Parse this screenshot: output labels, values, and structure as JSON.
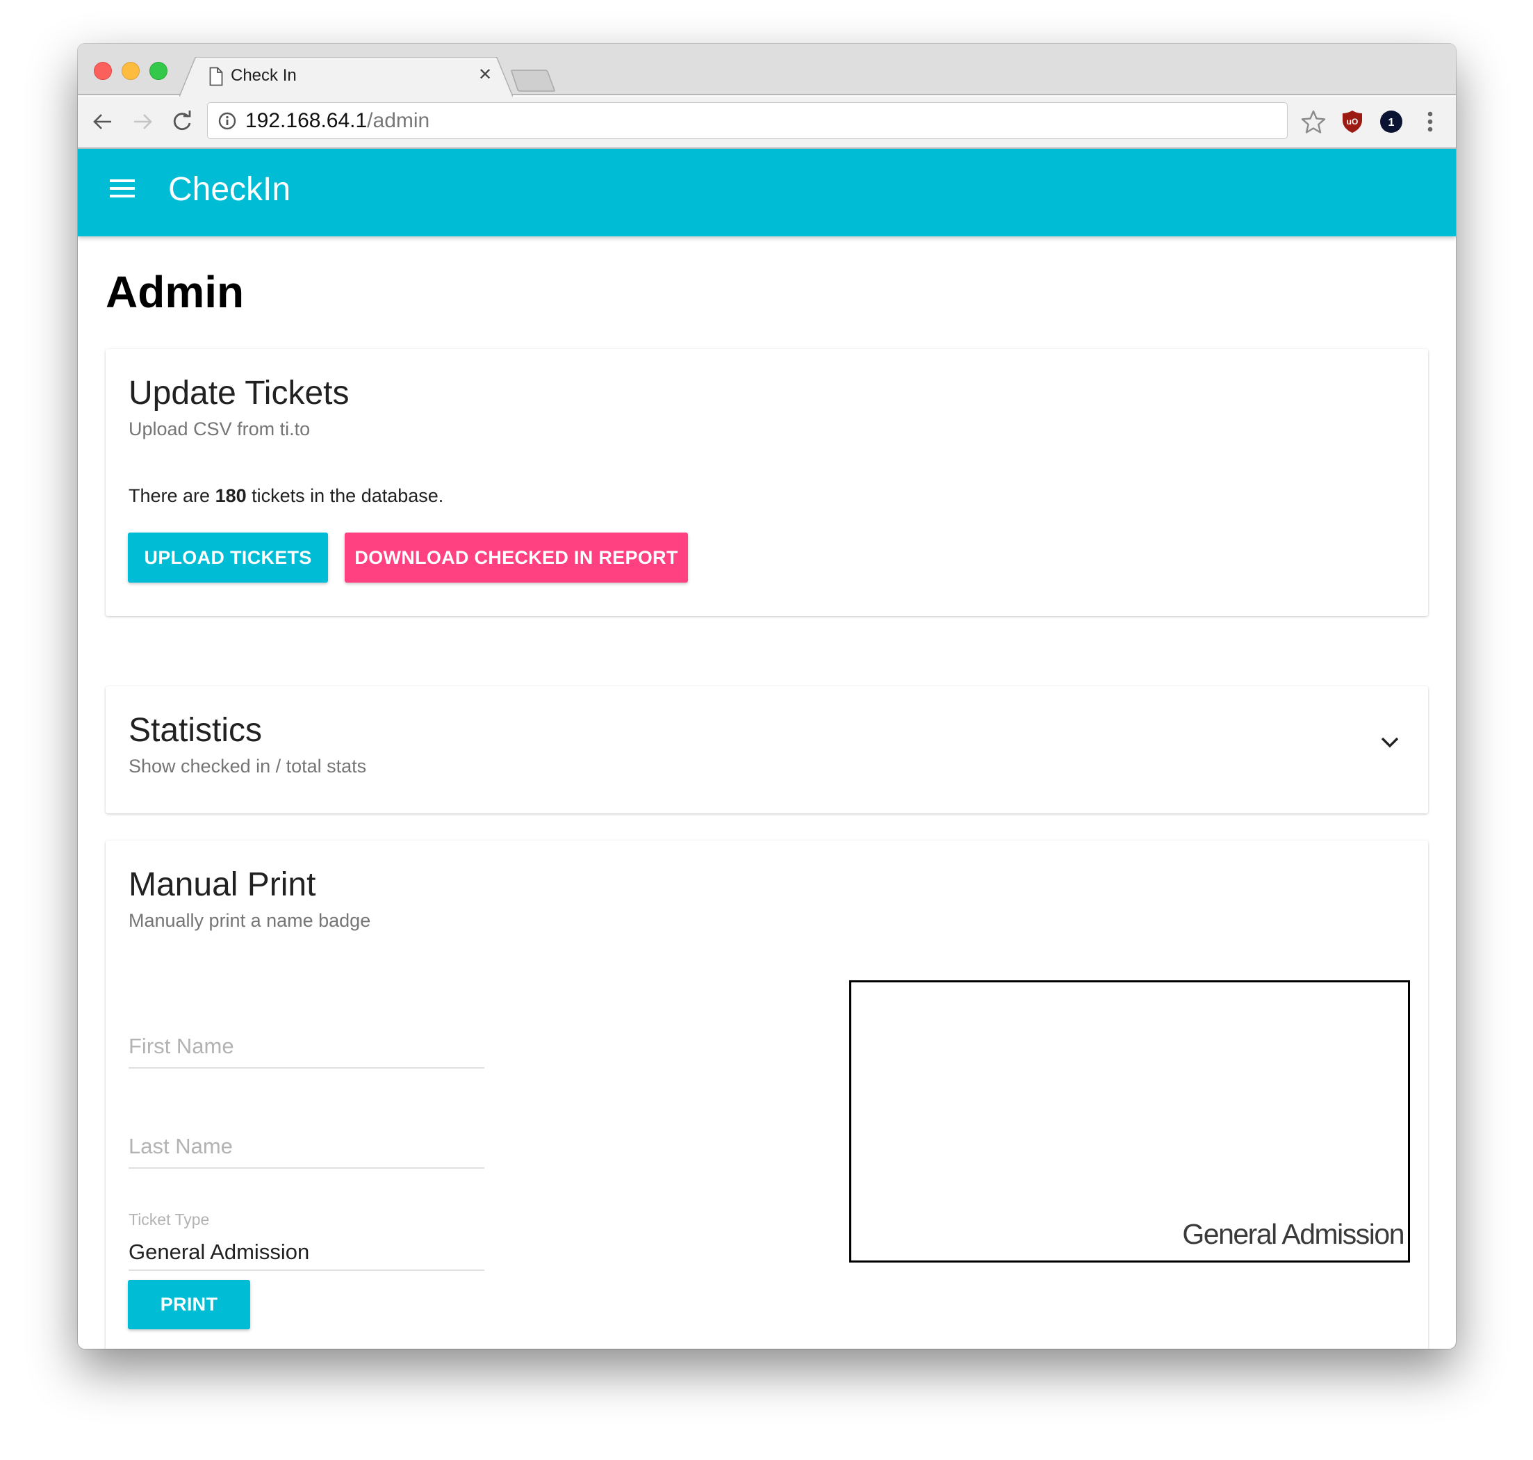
{
  "browser": {
    "tab_title": "Check In",
    "url_host": "192.168.64.1",
    "url_path": "/admin",
    "extensions": [
      {
        "name": "ublock-origin",
        "label": "uO",
        "color": "#9b1a12"
      },
      {
        "name": "1password",
        "label": "1",
        "color": "#0a1331"
      }
    ]
  },
  "appbar": {
    "title": "CheckIn",
    "color": "#00bcd4"
  },
  "page": {
    "title": "Admin"
  },
  "update_tickets": {
    "title": "Update Tickets",
    "subtitle": "Upload CSV from ti.to",
    "count_prefix": "There are ",
    "count": "180",
    "count_suffix": " tickets in the database.",
    "upload_label": "UPLOAD TICKETS",
    "download_label": "DOWNLOAD CHECKED IN REPORT",
    "accent_color": "#00bcd4",
    "secondary_color": "#ff4081"
  },
  "statistics": {
    "title": "Statistics",
    "subtitle": "Show checked in / total stats",
    "expanded": false
  },
  "manual_print": {
    "title": "Manual Print",
    "subtitle": "Manually print a name badge",
    "first_name": {
      "placeholder": "First Name",
      "value": ""
    },
    "last_name": {
      "placeholder": "Last Name",
      "value": ""
    },
    "ticket_type": {
      "label": "Ticket Type",
      "value": "General Admission"
    },
    "print_label": "PRINT",
    "badge_preview": {
      "first_name": "",
      "last_name": "",
      "ticket_type": "General Admission"
    }
  }
}
